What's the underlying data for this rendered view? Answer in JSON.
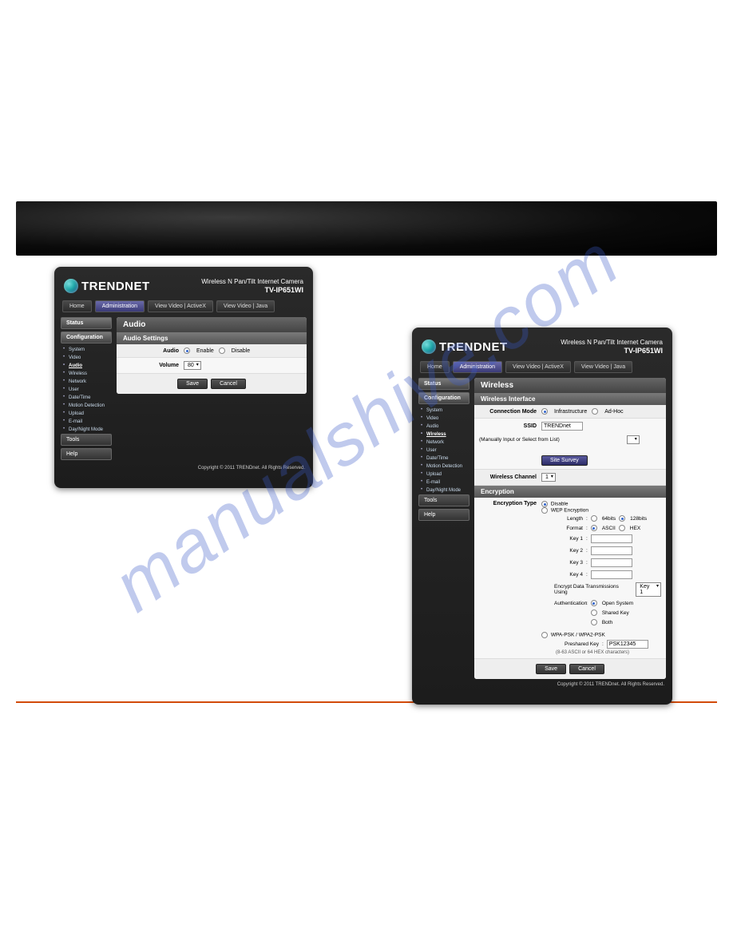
{
  "watermark": "manualshive.com",
  "header_title_line": "Wireless N Pan/Tilt Internet Camera",
  "header_model": "TV-IP651WI",
  "nav": {
    "home": "Home",
    "admin": "Administration",
    "view_ax": "View Video | ActiveX",
    "view_java": "View Video | Java"
  },
  "sidebar": {
    "status": "Status",
    "config": "Configuration",
    "tools": "Tools",
    "help": "Help",
    "items": [
      "System",
      "Video",
      "Audio",
      "Wireless",
      "Network",
      "User",
      "Date/Time",
      "Motion Detection",
      "Upload",
      "E-mail",
      "Day/Night Mode"
    ]
  },
  "audio": {
    "title": "Audio",
    "section": "Audio Settings",
    "label_audio": "Audio",
    "opt_enable": "Enable",
    "opt_disable": "Disable",
    "label_volume": "Volume",
    "volume_value": "80"
  },
  "wireless": {
    "title": "Wireless",
    "section_if": "Wireless Interface",
    "section_enc": "Encryption",
    "lbl_mode": "Connection Mode",
    "opt_infra": "Infrastructure",
    "opt_adhoc": "Ad-Hoc",
    "lbl_ssid": "SSID",
    "ssid_value": "TRENDnet",
    "ssid_hint": "(Manually Input or Select from List)",
    "site_survey": "Site Survey",
    "lbl_channel": "Wireless Channel",
    "channel_value": "1",
    "lbl_enc_type": "Encryption Type",
    "opt_disable": "Disable",
    "opt_wep": "WEP Encryption",
    "lbl_length": "Length",
    "opt_64": "64bits",
    "opt_128": "128bits",
    "lbl_format": "Format",
    "opt_ascii": "ASCII",
    "opt_hex": "HEX",
    "lbl_key1": "Key 1",
    "lbl_key2": "Key 2",
    "lbl_key3": "Key 3",
    "lbl_key4": "Key 4",
    "lbl_enc_using": "Encrypt Data Transmissions Using",
    "enc_using_value": "Key 1",
    "lbl_auth": "Authentication",
    "opt_open": "Open System",
    "opt_shared": "Shared Key",
    "opt_both": "Both",
    "opt_wpa": "WPA-PSK / WPA2-PSK",
    "lbl_psk": "Preshared Key",
    "psk_value": "PSK12345",
    "psk_hint": "(8-63 ASCII or 64 HEX characters)"
  },
  "buttons": {
    "save": "Save",
    "cancel": "Cancel"
  },
  "copyright": "Copyright © 2011 TRENDnet. All Rights Reserved."
}
